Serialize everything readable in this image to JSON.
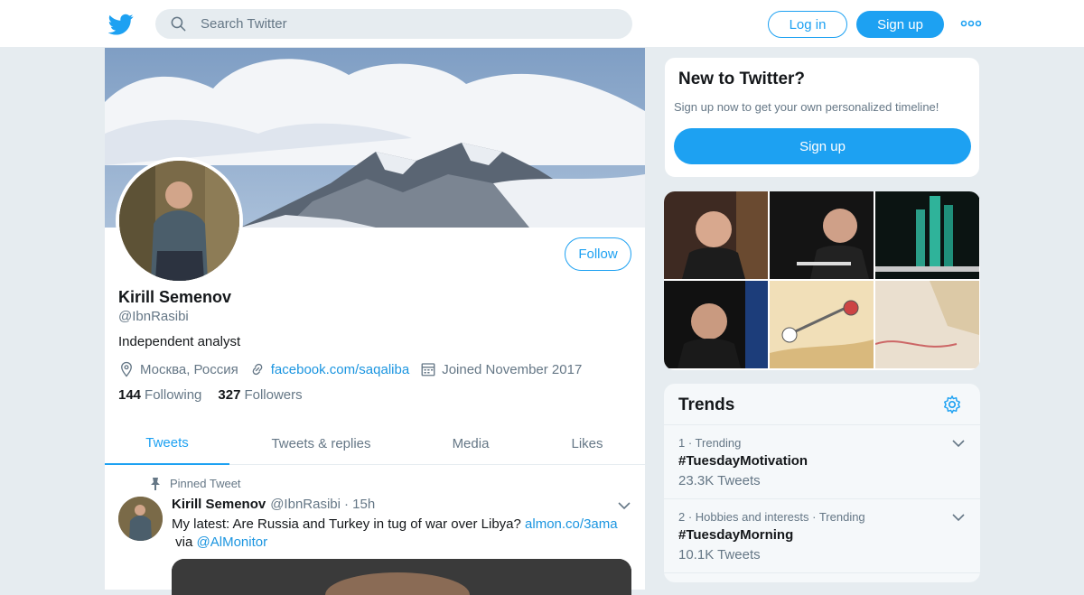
{
  "header": {
    "logo_icon": "twitter-bird-icon",
    "search_placeholder": "Search Twitter",
    "login_label": "Log in",
    "signup_label": "Sign up",
    "more_icon": "more-dots-icon",
    "brand_color": "#1da1f2"
  },
  "profile": {
    "follow_label": "Follow",
    "name": "Kirill Semenov",
    "handle": "@IbnRasibi",
    "bio": "Independent analyst",
    "location": "Москва, Россия",
    "website": "facebook.com/saqaliba",
    "joined": "Joined November 2017",
    "following_count": "144",
    "following_label": "Following",
    "followers_count": "327",
    "followers_label": "Followers"
  },
  "tabs": [
    {
      "label": "Tweets",
      "active": true
    },
    {
      "label": "Tweets & replies",
      "active": false
    },
    {
      "label": "Media",
      "active": false
    },
    {
      "label": "Likes",
      "active": false
    }
  ],
  "tweet": {
    "pinned_label": "Pinned Tweet",
    "author_name": "Kirill Semenov",
    "author_handle": "@IbnRasibi",
    "time": "· 15h",
    "text_1": "My latest: Are Russia and Turkey in tug of war over Libya?",
    "link_1": "almon.co/3ama",
    "text_2": "via",
    "link_2": "@AlMonitor"
  },
  "new_to_twitter": {
    "title": "New to Twitter?",
    "subtitle": "Sign up now to get your own personalized timeline!",
    "button_label": "Sign up"
  },
  "trends": {
    "title": "Trends",
    "items": [
      {
        "context": "1 · Trending",
        "tag": "#TuesdayMotivation",
        "count": "23.3K Tweets"
      },
      {
        "context": "2 · Hobbies and interests · Trending",
        "tag": "#TuesdayMorning",
        "count": "10.1K Tweets"
      }
    ]
  }
}
